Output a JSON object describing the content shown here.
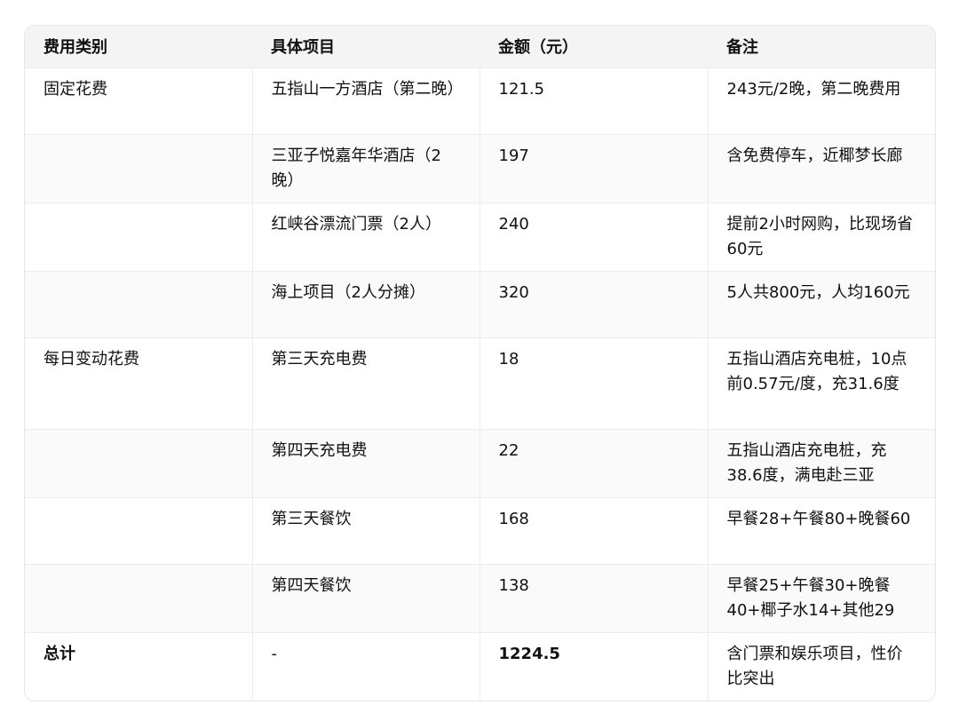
{
  "table": {
    "headers": [
      "费用类别",
      "具体项目",
      "金额（元）",
      "备注"
    ],
    "rows": [
      {
        "category": "固定花费",
        "item": "五指山一方酒店（第二晚）",
        "amount": "121.5",
        "note": "243元/2晚，第二晚费用"
      },
      {
        "category": "",
        "item": "三亚子悦嘉年华酒店（2晚）",
        "amount": "197",
        "note": "含免费停车，近椰梦长廊"
      },
      {
        "category": "",
        "item": "红峡谷漂流门票（2人）",
        "amount": "240",
        "note": "提前2小时网购，比现场省60元"
      },
      {
        "category": "",
        "item": "海上项目（2人分摊）",
        "amount": "320",
        "note": "5人共800元，人均160元"
      },
      {
        "category": "每日变动花费",
        "item": "第三天充电费",
        "amount": "18",
        "note": "五指山酒店充电桩，10点前0.57元/度，充31.6度"
      },
      {
        "category": "",
        "item": "第四天充电费",
        "amount": "22",
        "note": "五指山酒店充电桩，充38.6度，满电赴三亚"
      },
      {
        "category": "",
        "item": "第三天餐饮",
        "amount": "168",
        "note": "早餐28+午餐80+晚餐60"
      },
      {
        "category": "",
        "item": "第四天餐饮",
        "amount": "138",
        "note": "早餐25+午餐30+晚餐40+椰子水14+其他29"
      },
      {
        "category": "总计",
        "item": "-",
        "amount": "1224.5",
        "note": "含门票和娱乐项目，性价比突出"
      }
    ]
  }
}
